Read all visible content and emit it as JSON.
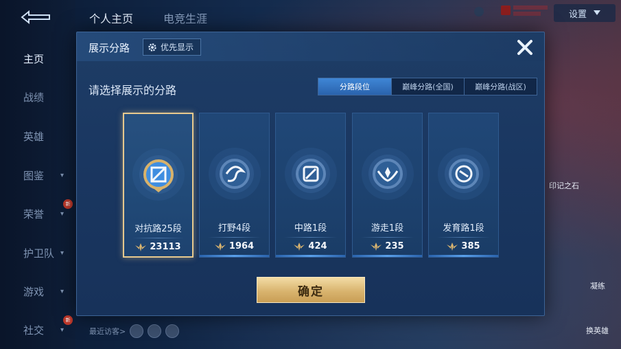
{
  "background": {
    "top_tabs": [
      "个人主页",
      "电竞生涯"
    ],
    "settings_label": "设置",
    "nav_items": [
      {
        "label": "主页",
        "active": true,
        "has_chevron": false,
        "new_badge": false
      },
      {
        "label": "战绩",
        "active": false,
        "has_chevron": false,
        "new_badge": false
      },
      {
        "label": "英雄",
        "active": false,
        "has_chevron": false,
        "new_badge": false
      },
      {
        "label": "图鉴",
        "active": false,
        "has_chevron": true,
        "new_badge": false
      },
      {
        "label": "荣誉",
        "active": false,
        "has_chevron": true,
        "new_badge": true
      },
      {
        "label": "护卫队",
        "active": false,
        "has_chevron": true,
        "new_badge": false
      },
      {
        "label": "游戏",
        "active": false,
        "has_chevron": true,
        "new_badge": false
      },
      {
        "label": "社交",
        "active": false,
        "has_chevron": true,
        "new_badge": true
      }
    ],
    "new_badge_text": "新",
    "recent_visitors_label": "最近访客>",
    "right_labels": {
      "top": "印记之石",
      "mid": "凝练",
      "bottom": "换英雄"
    }
  },
  "dialog": {
    "title": "展示分路",
    "priority_label": "优先显示",
    "subtitle": "请选择展示的分路",
    "segments": [
      {
        "label": "分路段位",
        "active": true
      },
      {
        "label": "巅峰分路(全国)",
        "active": false
      },
      {
        "label": "巅峰分路(战区)",
        "active": false
      }
    ],
    "cards": [
      {
        "name": "对抗路25段",
        "score": "23113",
        "selected": true,
        "icon": "clash-lane-emblem-icon"
      },
      {
        "name": "打野4段",
        "score": "1964",
        "selected": false,
        "icon": "jungle-emblem-icon"
      },
      {
        "name": "中路1段",
        "score": "424",
        "selected": false,
        "icon": "mid-lane-emblem-icon"
      },
      {
        "name": "游走1段",
        "score": "235",
        "selected": false,
        "icon": "roam-emblem-icon"
      },
      {
        "name": "发育路1段",
        "score": "385",
        "selected": false,
        "icon": "farm-lane-emblem-icon"
      }
    ],
    "confirm_label": "确定"
  },
  "colors": {
    "accent_blue": "#2a63ad",
    "gold": "#d9b46f",
    "selected_border": "#e7c98e"
  }
}
